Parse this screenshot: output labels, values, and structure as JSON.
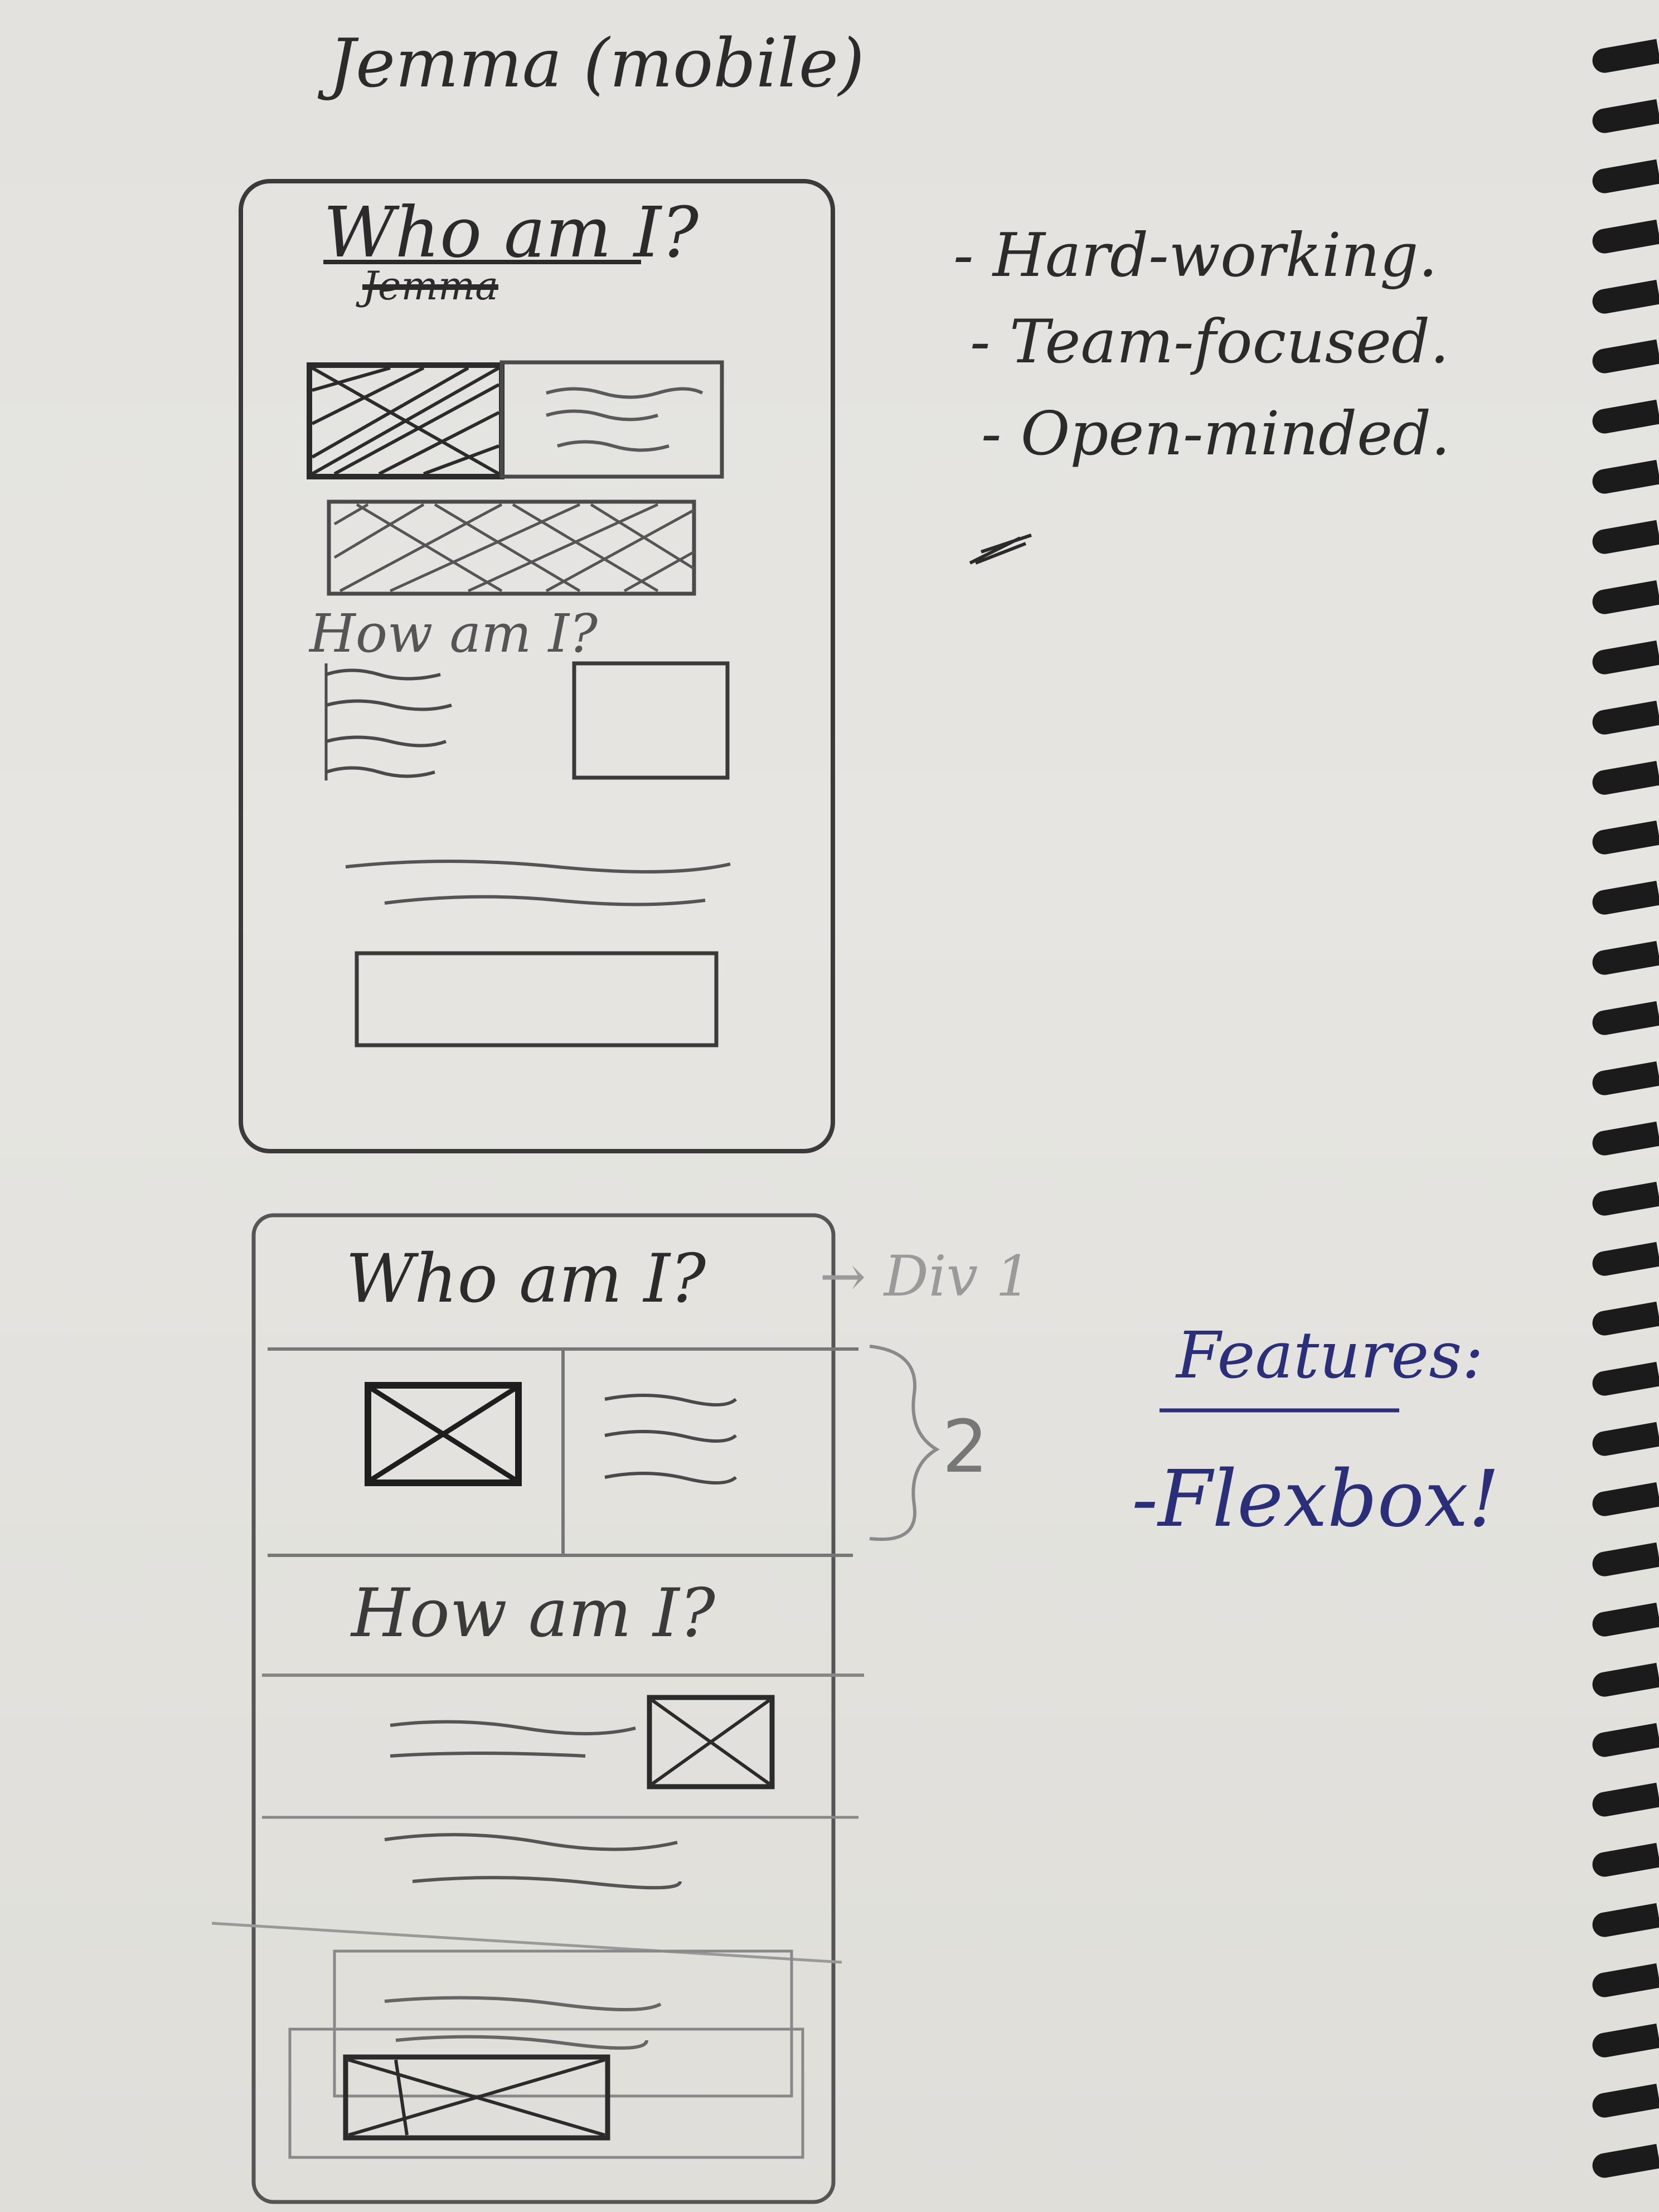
{
  "sheet": {
    "title": "Jemma (mobile)"
  },
  "mockup_mobile": {
    "heading_who": "Who am I?",
    "struck_word": "Jemma",
    "heading_how": "How am I?"
  },
  "traits": {
    "items": [
      "- Hard-working.",
      "- Team-focused.",
      "- Open-minded."
    ]
  },
  "mockup_layout": {
    "heading_who": "Who am I?",
    "div_note": "→ Div 1",
    "section_count": "2",
    "heading_how": "How am I?"
  },
  "features": {
    "title": "Features:",
    "item": "-Flexbox!"
  },
  "colors": {
    "pencil": "#6d6d6d",
    "ink_black": "#2b2b2b",
    "ink_blue": "#2b2f7a"
  }
}
